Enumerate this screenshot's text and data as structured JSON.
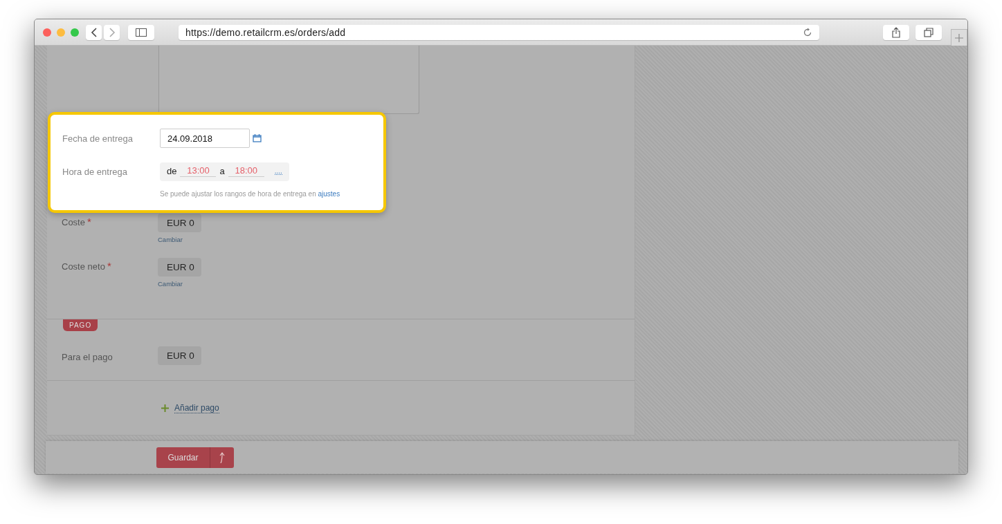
{
  "browser": {
    "url": "https://demo.retailcrm.es/orders/add"
  },
  "delivery_popup": {
    "date_label": "Fecha de entrega",
    "date_value": "24.09.2018",
    "time_label": "Hora de entrega",
    "from_label": "de",
    "from_value": "13:00",
    "to_label": "a",
    "to_value": "18:00",
    "more": "....",
    "hint": "Se puede ajustar los rangos de hora de entrega en",
    "hint_link": "ajustes"
  },
  "cost_fields": [
    {
      "label": "Coste",
      "required_mark": "*",
      "value": "EUR 0",
      "action": "Cambiar"
    },
    {
      "label": "Coste neto",
      "required_mark": "*",
      "value": "EUR 0",
      "action": "Cambiar"
    }
  ],
  "payment": {
    "section_tag": "PAGO",
    "fields": [
      {
        "label": "Para el pago",
        "value": "EUR 0"
      }
    ],
    "add_link": "Añadir pago"
  },
  "actions": {
    "save": "Guardar"
  }
}
